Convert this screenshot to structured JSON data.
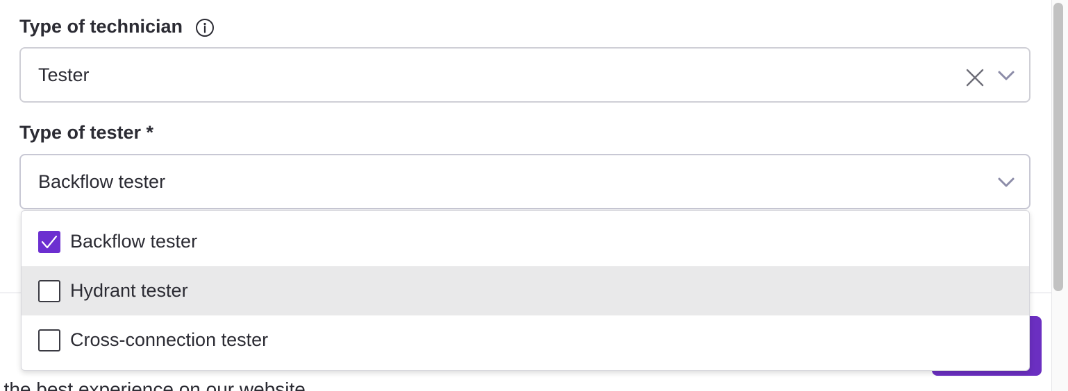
{
  "form": {
    "technician_label": "Type of technician",
    "technician_value": "Tester",
    "tester_label": "Type of tester *",
    "tester_value": "Backflow tester"
  },
  "dropdown": {
    "options": [
      {
        "label": "Backflow tester",
        "checked": true
      },
      {
        "label": "Hydrant tester",
        "checked": false
      },
      {
        "label": "Cross-connection tester",
        "checked": false
      }
    ]
  },
  "background": {
    "cookie_text": "t the best experience on our website."
  },
  "icons": {
    "info": "info-icon",
    "clear": "close-icon",
    "chevron": "chevron-down-icon",
    "check": "check-icon"
  },
  "colors": {
    "accent": "#6c2fd0",
    "hover_row": "#e9e9ea",
    "border": "#cfcfd6",
    "text": "#2b2b33"
  }
}
